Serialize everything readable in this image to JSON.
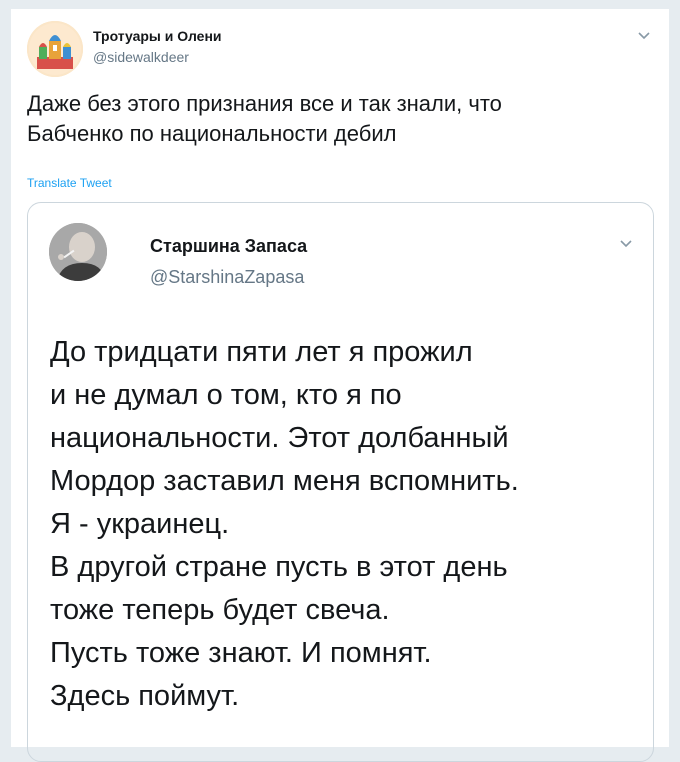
{
  "tweet": {
    "author": {
      "name": "Тротуары и Олени",
      "handle": "@sidewalkdeer"
    },
    "text": "Даже без этого признания все и так знали, что\nБабченко по национальности дебил",
    "translate_label": "Translate Tweet"
  },
  "quoted_tweet": {
    "author": {
      "name": "Старшина Запаса",
      "handle": "@StarshinaZapasa"
    },
    "lines": [
      "До тридцати пяти лет я прожил",
      "и не думал о том, кто я по",
      "национальности. Этот долбанный",
      "Мордор заставил меня вспомнить.",
      "Я - украинец.",
      "В другой стране пусть в этот день",
      "тоже теперь будет свеча.",
      "Пусть тоже знают. И помнят.",
      "Здесь поймут."
    ]
  },
  "icons": {
    "main_caret": "chevron-down-icon",
    "quote_caret": "chevron-down-icon"
  },
  "colors": {
    "link": "#1da1f2",
    "secondary_text": "#657786",
    "border": "#ccd6dd",
    "background": "#e6ecf0"
  }
}
